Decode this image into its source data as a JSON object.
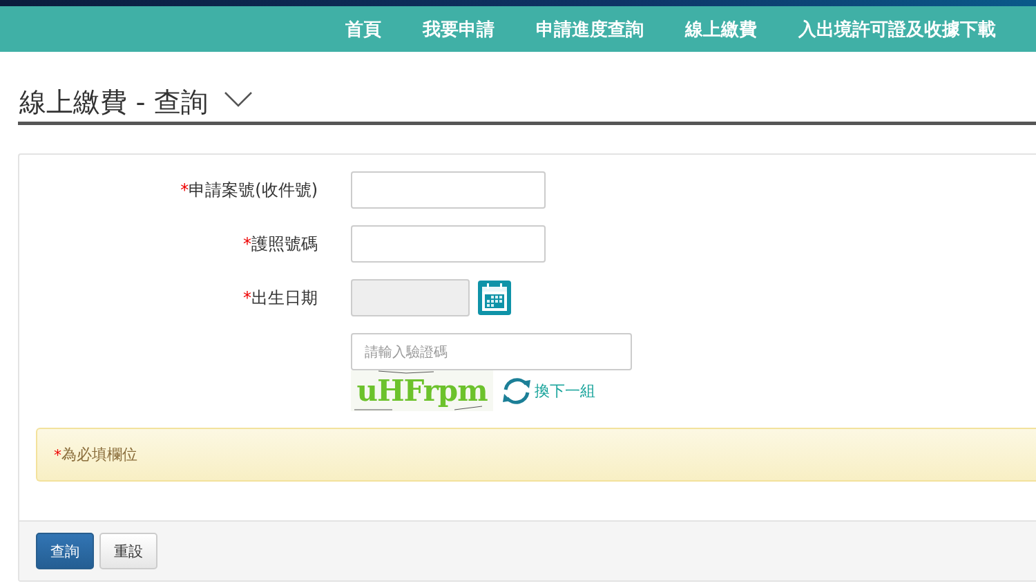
{
  "nav": [
    {
      "label": "首頁"
    },
    {
      "label": "我要申請"
    },
    {
      "label": "申請進度查詢"
    },
    {
      "label": "線上繳費"
    },
    {
      "label": "入出境許可證及收據下載"
    }
  ],
  "page_title": "線上繳費 - 查詢",
  "form": {
    "fields": [
      {
        "label": "申請案號(收件號)",
        "required": true,
        "disabled": false,
        "kind": "text"
      },
      {
        "label": "護照號碼",
        "required": true,
        "disabled": false,
        "kind": "text"
      },
      {
        "label": "出生日期",
        "required": true,
        "disabled": true,
        "kind": "date"
      }
    ],
    "captcha": {
      "placeholder": "請輸入驗證碼",
      "code": "uHFrpm",
      "refresh_label": "換下一組"
    },
    "notice": {
      "required_mark": "*",
      "text": "為必填欄位"
    },
    "buttons": [
      {
        "label": "查詢",
        "kind": "primary"
      },
      {
        "label": "重設",
        "kind": "default"
      }
    ]
  }
}
